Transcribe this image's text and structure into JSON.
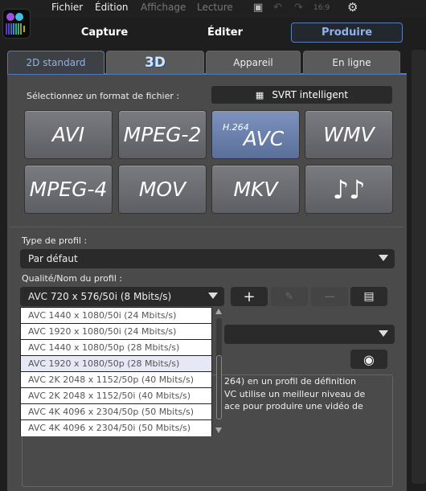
{
  "menu": {
    "items": [
      "Fichier",
      "Édition",
      "Affichage",
      "Lecture"
    ],
    "disabled": [
      false,
      false,
      true,
      true
    ],
    "ratio": "16:9"
  },
  "modes": {
    "capture": "Capture",
    "edit": "Éditer",
    "produce": "Produire"
  },
  "tabs": [
    "2D standard",
    "3D",
    "Appareil",
    "En ligne"
  ],
  "format": {
    "label": "Sélectionnez un format de fichier :",
    "svrt": "SVRT intelligent",
    "buttons": [
      "AVI",
      "MPEG-2",
      "AVC",
      "WMV",
      "MPEG-4",
      "MOV",
      "MKV",
      "♪♪"
    ],
    "avc_sup": "H.264",
    "selected": "AVC"
  },
  "profile_type": {
    "label": "Type de profil :",
    "value": "Par défaut"
  },
  "quality": {
    "label": "Qualité/Nom du profil :",
    "value": "AVC 720 x 576/50i (8 Mbits/s)",
    "options": [
      "AVC 1440 x 1080/50i (24 Mbits/s)",
      "AVC 1920 x 1080/50i (24 Mbits/s)",
      "AVC 1440 x 1080/50p (28 Mbits/s)",
      "AVC 1920 x 1080/50p (28 Mbits/s)",
      "AVC 2K 2048 x 1152/50p (40 Mbits/s)",
      "AVC 2K 2048 x 1152/50i (40 Mbits/s)",
      "AVC 4K 4096 x 2304/50p (50 Mbits/s)",
      "AVC 4K 4096 x 2304/50i (50 Mbits/s)"
    ],
    "highlighted": 3
  },
  "description": [
    "264) en un profil de définition",
    "VC utilise un meilleur niveau de",
    "ace pour produire une vidéo de"
  ],
  "colors": {
    "accent": "#4d7ac0",
    "panel": "#4a4a4a"
  }
}
